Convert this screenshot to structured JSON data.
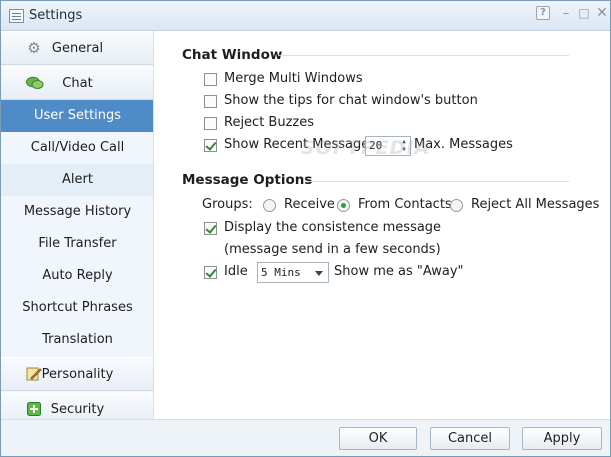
{
  "window": {
    "title": "Settings"
  },
  "titlebar_buttons": {
    "help": "?",
    "minimize": "–",
    "maximize": "□",
    "close": "✕"
  },
  "sidebar": {
    "categories": [
      {
        "label": "General",
        "icon": "gear-icon"
      },
      {
        "label": "Chat",
        "icon": "chat-bubbles-icon"
      },
      {
        "label": "Personality",
        "icon": "pencil-icon"
      },
      {
        "label": "Security",
        "icon": "shield-icon"
      }
    ],
    "chat_items": [
      "User Settings",
      "Call/Video Call",
      "Alert",
      "Message History",
      "File Transfer",
      "Auto Reply",
      "Shortcut Phrases",
      "Translation"
    ],
    "selected": "User Settings"
  },
  "chat_window": {
    "title": "Chat Window",
    "merge_multi_windows": {
      "label": "Merge Multi Windows",
      "checked": false
    },
    "show_tips": {
      "label": "Show the tips for chat window's button",
      "checked": false
    },
    "reject_buzzes": {
      "label": "Reject Buzzes",
      "checked": false
    },
    "show_recent": {
      "label": "Show Recent Messages",
      "checked": true,
      "value": "20",
      "suffix": "Max. Messages"
    }
  },
  "message_options": {
    "title": "Message Options",
    "groups_label": "Groups:",
    "groups_options": [
      "Receive",
      "From Contacts",
      "Reject All Messages"
    ],
    "groups_selected": "From Contacts",
    "consistence": {
      "label": "Display the consistence message",
      "checked": true,
      "note": "(message send in a few seconds)"
    },
    "idle": {
      "label": "Idle",
      "checked": true,
      "value": "5 Mins",
      "suffix": "Show me as \"Away\""
    }
  },
  "footer": {
    "ok": "OK",
    "cancel": "Cancel",
    "apply": "Apply"
  },
  "watermark": "SOFTPEDIA",
  "colors": {
    "selected_item": "#4f8bc7",
    "check": "#2f8a2f",
    "window_border": "#7a9bb8"
  }
}
